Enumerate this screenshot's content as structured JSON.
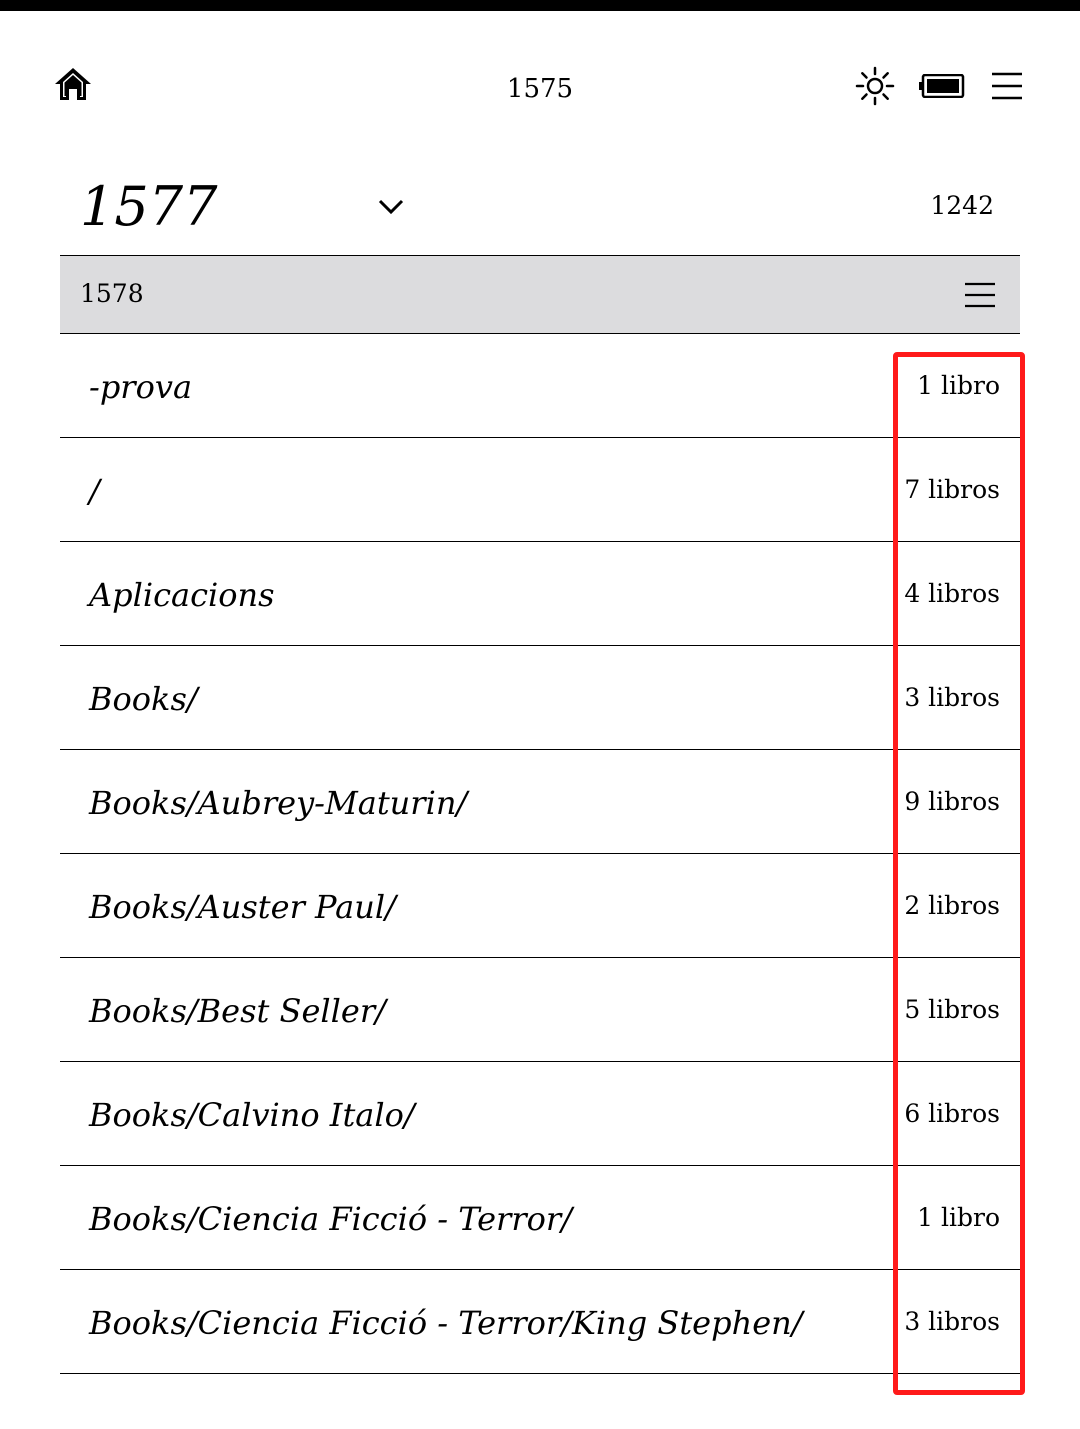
{
  "status_bar": {
    "title": "1575",
    "icons": [
      "home-icon",
      "brightness-icon",
      "battery-icon",
      "menu-icon"
    ]
  },
  "header": {
    "title": "1577",
    "count": "1242"
  },
  "sort_bar": {
    "label": "1578"
  },
  "list": {
    "items": [
      {
        "name": "-prova",
        "count": "1 libro"
      },
      {
        "name": "/",
        "count": "7 libros"
      },
      {
        "name": "Aplicacions",
        "count": "4 libros"
      },
      {
        "name": "Books/",
        "count": "3 libros"
      },
      {
        "name": "Books/Aubrey-Maturin/",
        "count": "9 libros"
      },
      {
        "name": "Books/Auster Paul/",
        "count": "2 libros"
      },
      {
        "name": "Books/Best Seller/",
        "count": "5 libros"
      },
      {
        "name": "Books/Calvino Italo/",
        "count": "6 libros"
      },
      {
        "name": "Books/Ciencia Ficció - Terror/",
        "count": "1 libro"
      },
      {
        "name": "Books/Ciencia Ficció - Terror/King Stephen/",
        "count": "3 libros"
      }
    ]
  },
  "colors": {
    "background": "#ffffff",
    "sort_bar_background": "#dcdcde",
    "highlight": "#ff1a1a"
  }
}
